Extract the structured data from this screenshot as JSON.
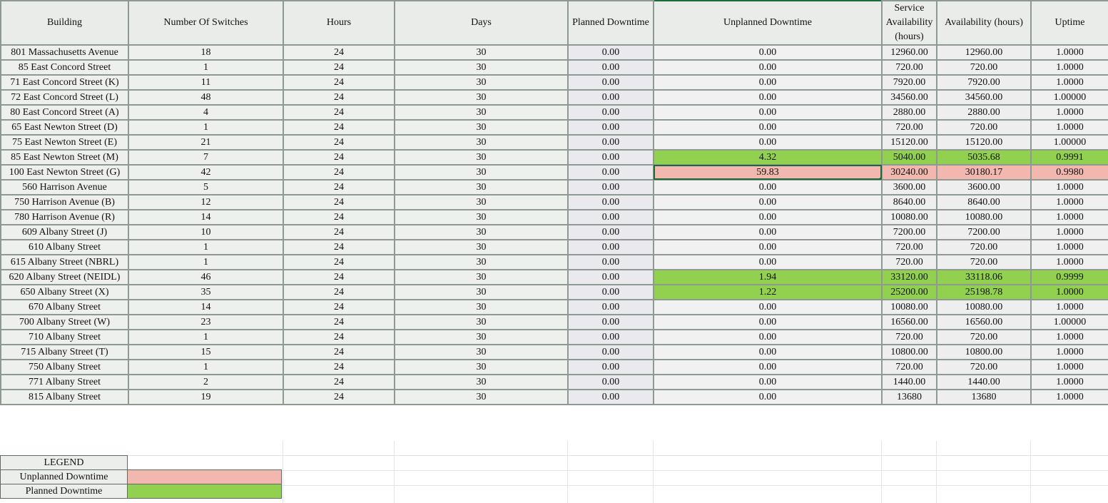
{
  "headers": [
    "Building",
    "Number Of Switches",
    "Hours",
    "Days",
    "Planned Downtime",
    "Unplanned Downtime",
    "Service Availability (hours)",
    "Availability (hours)",
    "Uptime"
  ],
  "rows": [
    [
      "801 Massachusetts Avenue",
      "18",
      "24",
      "30",
      "0.00",
      "0.00",
      "12960.00",
      "12960.00",
      "1.0000"
    ],
    [
      "85 East Concord Street",
      "1",
      "24",
      "30",
      "0.00",
      "0.00",
      "720.00",
      "720.00",
      "1.0000"
    ],
    [
      "71 East Concord Street (K)",
      "11",
      "24",
      "30",
      "0.00",
      "0.00",
      "7920.00",
      "7920.00",
      "1.0000"
    ],
    [
      "72 East Concord Street (L)",
      "48",
      "24",
      "30",
      "0.00",
      "0.00",
      "34560.00",
      "34560.00",
      "1.00000"
    ],
    [
      "80 East Concord Street (A)",
      "4",
      "24",
      "30",
      "0.00",
      "0.00",
      "2880.00",
      "2880.00",
      "1.0000"
    ],
    [
      "65 East Newton Street (D)",
      "1",
      "24",
      "30",
      "0.00",
      "0.00",
      "720.00",
      "720.00",
      "1.0000"
    ],
    [
      "75 East Newton Street (E)",
      "21",
      "24",
      "30",
      "0.00",
      "0.00",
      "15120.00",
      "15120.00",
      "1.00000"
    ],
    [
      "85 East Newton Street (M)",
      "7",
      "24",
      "30",
      "0.00",
      "4.32",
      "5040.00",
      "5035.68",
      "0.9991"
    ],
    [
      "100 East Newton Street (G)",
      "42",
      "24",
      "30",
      "0.00",
      "59.83",
      "30240.00",
      "30180.17",
      "0.9980"
    ],
    [
      "560 Harrison Avenue",
      "5",
      "24",
      "30",
      "0.00",
      "0.00",
      "3600.00",
      "3600.00",
      "1.0000"
    ],
    [
      "750 Harrison Avenue (B)",
      "12",
      "24",
      "30",
      "0.00",
      "0.00",
      "8640.00",
      "8640.00",
      "1.0000"
    ],
    [
      "780 Harrison Avenue (R)",
      "14",
      "24",
      "30",
      "0.00",
      "0.00",
      "10080.00",
      "10080.00",
      "1.0000"
    ],
    [
      "609 Albany Street (J)",
      "10",
      "24",
      "30",
      "0.00",
      "0.00",
      "7200.00",
      "7200.00",
      "1.0000"
    ],
    [
      "610 Albany Street",
      "1",
      "24",
      "30",
      "0.00",
      "0.00",
      "720.00",
      "720.00",
      "1.0000"
    ],
    [
      "615 Albany Street (NBRL)",
      "1",
      "24",
      "30",
      "0.00",
      "0.00",
      "720.00",
      "720.00",
      "1.0000"
    ],
    [
      "620 Albany Street (NEIDL)",
      "46",
      "24",
      "30",
      "0.00",
      "1.94",
      "33120.00",
      "33118.06",
      "0.9999"
    ],
    [
      "650 Albany Street (X)",
      "35",
      "24",
      "30",
      "0.00",
      "1.22",
      "25200.00",
      "25198.78",
      "1.0000"
    ],
    [
      "670 Albany Street",
      "14",
      "24",
      "30",
      "0.00",
      "0.00",
      "10080.00",
      "10080.00",
      "1.0000"
    ],
    [
      "700 Albany Street (W)",
      "23",
      "24",
      "30",
      "0.00",
      "0.00",
      "16560.00",
      "16560.00",
      "1.00000"
    ],
    [
      "710 Albany Street",
      "1",
      "24",
      "30",
      "0.00",
      "0.00",
      "720.00",
      "720.00",
      "1.0000"
    ],
    [
      "715 Albany Street (T)",
      "15",
      "24",
      "30",
      "0.00",
      "0.00",
      "10800.00",
      "10800.00",
      "1.0000"
    ],
    [
      "750 Albany Street",
      "1",
      "24",
      "30",
      "0.00",
      "0.00",
      "720.00",
      "720.00",
      "1.0000"
    ],
    [
      "771 Albany Street",
      "2",
      "24",
      "30",
      "0.00",
      "0.00",
      "1440.00",
      "1440.00",
      "1.0000"
    ],
    [
      "815 Albany Street",
      "19",
      "24",
      "30",
      "0.00",
      "0.00",
      "13680",
      "13680",
      "1.0000"
    ]
  ],
  "highlights": {
    "green_rows": [
      7,
      15,
      16
    ],
    "red_rows": [
      8
    ],
    "selected_cell": {
      "row": 8,
      "col": 5
    }
  },
  "legend": {
    "title": "LEGEND",
    "unplanned_label": "Unplanned Downtime",
    "planned_label": "Planned Downtime"
  },
  "colors": {
    "green": "#92d050",
    "red": "#f2b8b0",
    "grid_border": "#8e9a91",
    "selection": "#1e6b3a"
  }
}
